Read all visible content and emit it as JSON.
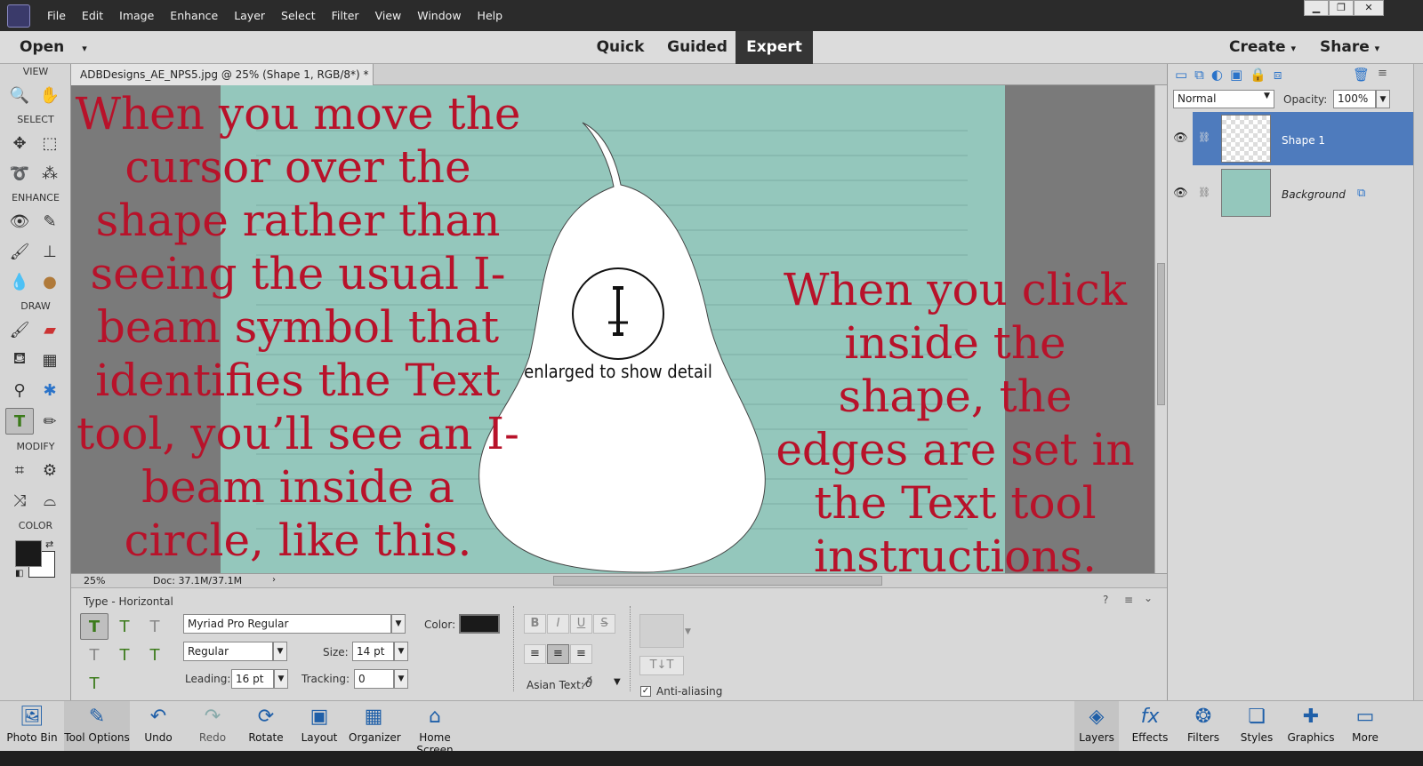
{
  "menubar": {
    "items": [
      "File",
      "Edit",
      "Image",
      "Enhance",
      "Layer",
      "Select",
      "Filter",
      "View",
      "Window",
      "Help"
    ]
  },
  "modebar": {
    "open": "Open",
    "modes": [
      "Quick",
      "Guided",
      "Expert"
    ],
    "active": "Expert",
    "create": "Create",
    "share": "Share"
  },
  "toolbar": {
    "sections": [
      "VIEW",
      "SELECT",
      "ENHANCE",
      "DRAW",
      "MODIFY",
      "COLOR"
    ]
  },
  "document": {
    "tab_title": "ADBDesigns_AE_NPS5.jpg @ 25% (Shape 1, RGB/8*) *",
    "zoom": "25%",
    "doc_size": "Doc: 37.1M/37.1M",
    "annotation_left": "When you move the cursor over the shape rather than seeing the usual I-beam symbol that identifies the Text tool, you’ll see an I-beam inside a circle, like this.",
    "annotation_right": "When you click inside the shape, the edges are set in the Text tool instructions.",
    "detail_caption": "enlarged to show detail"
  },
  "options": {
    "title": "Type - Horizontal",
    "font": "Myriad Pro Regular",
    "style": "Regular",
    "size_label": "Size:",
    "size": "14 pt",
    "leading_label": "Leading:",
    "leading": "16 pt",
    "tracking_label": "Tracking:",
    "tracking": "0",
    "color_label": "Color:",
    "asian_text": "Asian Text:",
    "anti_aliasing": "Anti-aliasing"
  },
  "layers": {
    "blend_mode": "Normal",
    "opacity_label": "Opacity:",
    "opacity": "100%",
    "items": [
      {
        "name": "Shape 1"
      },
      {
        "name": "Background"
      }
    ]
  },
  "bottom_left": [
    "Photo Bin",
    "Tool Options",
    "Undo",
    "Redo",
    "Rotate",
    "Layout",
    "Organizer",
    "Home Screen"
  ],
  "bottom_right": [
    "Layers",
    "Effects",
    "Filters",
    "Styles",
    "Graphics",
    "More"
  ],
  "colors": {
    "annotation": "#b8122a",
    "paper": "#94c7bc",
    "layer_selected": "#4e7bbd"
  }
}
